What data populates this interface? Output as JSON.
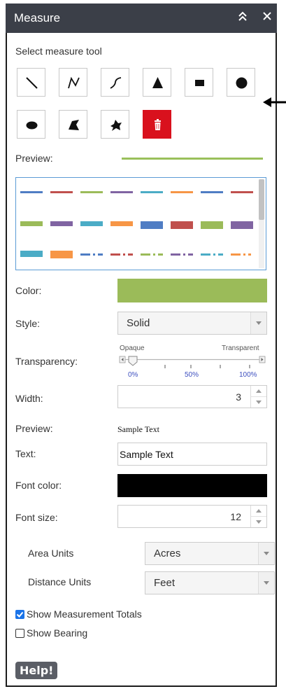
{
  "header": {
    "title": "Measure",
    "collapse_icon": "double-chevron-up-icon",
    "close_icon": "close-icon",
    "collapse_glyph": "≈",
    "close_glyph": "✕"
  },
  "tools": {
    "label": "Select measure tool",
    "items": [
      {
        "name": "line-tool",
        "icon": "line-icon"
      },
      {
        "name": "polyline-tool",
        "icon": "polyline-icon"
      },
      {
        "name": "freehand-polyline-tool",
        "icon": "freehand-line-icon"
      },
      {
        "name": "triangle-tool",
        "icon": "triangle-icon"
      },
      {
        "name": "rectangle-tool",
        "icon": "rectangle-icon"
      },
      {
        "name": "circle-tool",
        "icon": "circle-icon"
      },
      {
        "name": "ellipse-tool",
        "icon": "ellipse-icon"
      },
      {
        "name": "polygon-tool",
        "icon": "polygon-icon"
      },
      {
        "name": "freehand-polygon-tool",
        "icon": "freehand-polygon-icon"
      },
      {
        "name": "clear-tool",
        "icon": "trash-icon"
      }
    ]
  },
  "preview_label": "Preview:",
  "preview_line_color": "#9ac05b",
  "swatch_colors": [
    "#4f7dc4",
    "#c0504d",
    "#9bbb59",
    "#8064a2",
    "#4bacc6",
    "#f79646"
  ],
  "color_label": "Color:",
  "color_value": "#9bbb59",
  "style_label": "Style:",
  "style_value": "Solid",
  "transparency": {
    "label": "Transparency:",
    "left_label": "Opaque",
    "right_label": "Transparent",
    "ticks": [
      "0%",
      "50%",
      "100%"
    ],
    "value_fraction": 0.0
  },
  "width_label": "Width:",
  "width_value": "3",
  "text_preview_label": "Preview:",
  "text_preview_value": "Sample Text",
  "text_label": "Text:",
  "text_value": "Sample Text",
  "font_color_label": "Font color:",
  "font_color_value": "#000000",
  "font_size_label": "Font size:",
  "font_size_value": "12",
  "area_units_label": "Area Units",
  "area_units_value": "Acres",
  "distance_units_label": "Distance Units",
  "distance_units_value": "Feet",
  "show_totals": {
    "label": "Show Measurement Totals",
    "checked": true
  },
  "show_bearing": {
    "label": "Show Bearing",
    "checked": false
  },
  "help_label": "Help!",
  "accent_color": "#1a73e8",
  "trash_color": "#d9111d"
}
